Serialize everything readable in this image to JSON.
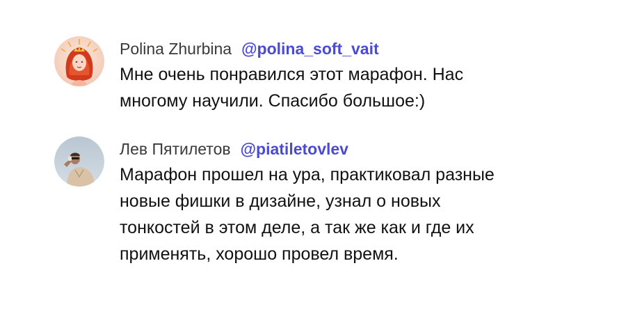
{
  "comments": [
    {
      "author": "Polina Zhurbina",
      "handle": "@polina_soft_vait",
      "text": "Мне очень понравился этот марафон. Нас\nмногому научили. Спасибо большое:)",
      "avatar": "illustrated-girl-avatar"
    },
    {
      "author": "Лев Пятилетов",
      "handle": "@piatiletovlev",
      "text": "Марафон прошел на ура, практиковал разные\nновые фишки в дизайне, узнал о новых\nтонкостей в этом деле, а так же как и где их\nприменять, хорошо провел время.",
      "avatar": "photo-man-avatar"
    }
  ],
  "colors": {
    "author": "#3a3a3a",
    "handle": "#4a4ad4",
    "text": "#111111",
    "background": "#ffffff"
  }
}
